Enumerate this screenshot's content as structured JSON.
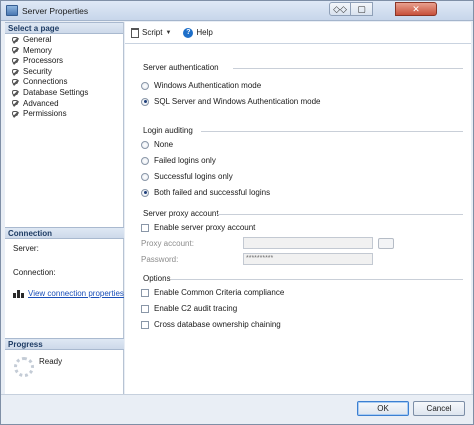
{
  "window": {
    "title": "Server Properties"
  },
  "title_buttons": {
    "restore": "◇◇",
    "minimize": "▢",
    "close": "✕"
  },
  "left_pane": {
    "select_header": "Select a page",
    "pages": [
      "General",
      "Memory",
      "Processors",
      "Security",
      "Connections",
      "Database Settings",
      "Advanced",
      "Permissions"
    ],
    "connection_header": "Connection",
    "server_label": "Server:",
    "connection_label": "Connection:",
    "view_link": "View connection properties",
    "progress_header": "Progress",
    "progress_status": "Ready"
  },
  "toolbar": {
    "script_label": "Script",
    "caret": "▼",
    "help_label": "Help",
    "help_glyph": "?"
  },
  "server_authentication": {
    "label": "Server authentication",
    "options": [
      {
        "label": "Windows Authentication mode",
        "selected": false
      },
      {
        "label": "SQL Server and Windows Authentication mode",
        "selected": true
      }
    ]
  },
  "login_auditing": {
    "label": "Login auditing",
    "options": [
      {
        "label": "None",
        "selected": false
      },
      {
        "label": "Failed logins only",
        "selected": false
      },
      {
        "label": "Successful logins only",
        "selected": false
      },
      {
        "label": "Both failed and successful logins",
        "selected": true
      }
    ]
  },
  "proxy": {
    "label": "Server proxy account",
    "enable_label": "Enable server proxy account",
    "enable_checked": false,
    "account_label": "Proxy account:",
    "account_value": "",
    "password_label": "Password:",
    "password_value": "**********"
  },
  "options": {
    "label": "Options",
    "items": [
      {
        "label": "Enable Common Criteria compliance",
        "checked": false
      },
      {
        "label": "Enable C2 audit tracing",
        "checked": false
      },
      {
        "label": "Cross database ownership chaining",
        "checked": false
      }
    ]
  },
  "buttons": {
    "ok": "OK",
    "cancel": "Cancel"
  }
}
